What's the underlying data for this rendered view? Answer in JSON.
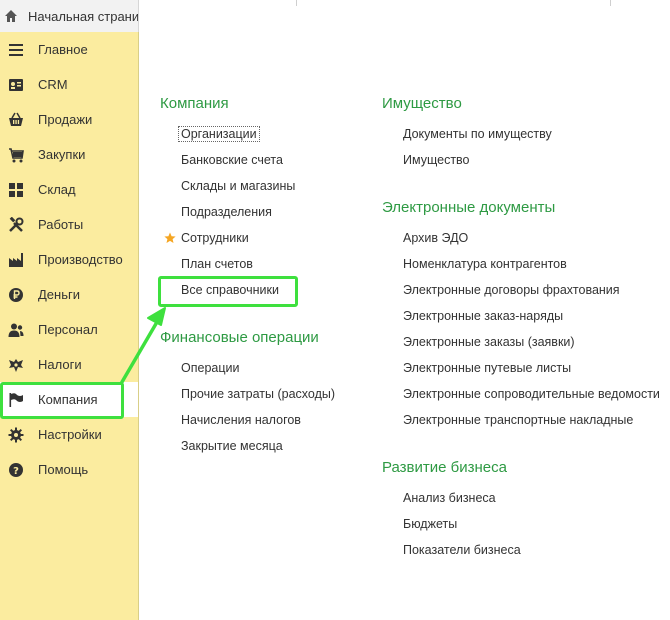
{
  "topbar": {
    "home_tab_label": "Начальная страница"
  },
  "sidebar": {
    "items": [
      {
        "label": "Главное",
        "icon": "menu-lines-icon"
      },
      {
        "label": "CRM",
        "icon": "contact-card-icon"
      },
      {
        "label": "Продажи",
        "icon": "basket-icon"
      },
      {
        "label": "Закупки",
        "icon": "cart-icon"
      },
      {
        "label": "Склад",
        "icon": "grid-icon"
      },
      {
        "label": "Работы",
        "icon": "tools-icon"
      },
      {
        "label": "Производство",
        "icon": "factory-icon"
      },
      {
        "label": "Деньги",
        "icon": "ruble-coin-icon"
      },
      {
        "label": "Персонал",
        "icon": "people-icon"
      },
      {
        "label": "Налоги",
        "icon": "eagle-emblem-icon"
      },
      {
        "label": "Компания",
        "icon": "flag-icon"
      },
      {
        "label": "Настройки",
        "icon": "gear-icon"
      },
      {
        "label": "Помощь",
        "icon": "help-icon"
      }
    ],
    "active": "Компания"
  },
  "content": {
    "left": {
      "company": {
        "title": "Компания",
        "links": [
          "Организации",
          "Банковские счета",
          "Склады и магазины",
          "Подразделения",
          "Сотрудники",
          "План счетов",
          "Все справочники"
        ]
      },
      "finance": {
        "title": "Финансовые операции",
        "links": [
          "Операции",
          "Прочие затраты (расходы)",
          "Начисления налогов",
          "Закрытие месяца"
        ]
      }
    },
    "right": {
      "property": {
        "title": "Имущество",
        "links": [
          "Документы по имуществу",
          "Имущество"
        ]
      },
      "edocs": {
        "title": "Электронные документы",
        "links": [
          "Архив ЭДО",
          "Номенклатура контрагентов",
          "Электронные договоры фрахтования",
          "Электронные заказ-наряды",
          "Электронные заказы (заявки)",
          "Электронные путевые листы",
          "Электронные сопроводительные ведомости",
          "Электронные транспортные накладные"
        ]
      },
      "business": {
        "title": "Развитие бизнеса",
        "links": [
          "Анализ бизнеса",
          "Бюджеты",
          "Показатели бизнеса"
        ]
      }
    }
  },
  "colors": {
    "sidebar_bg": "#fbec9f",
    "section_title": "#2e9a43",
    "highlight": "#3ee03e",
    "favorite_star": "#f5a623"
  }
}
